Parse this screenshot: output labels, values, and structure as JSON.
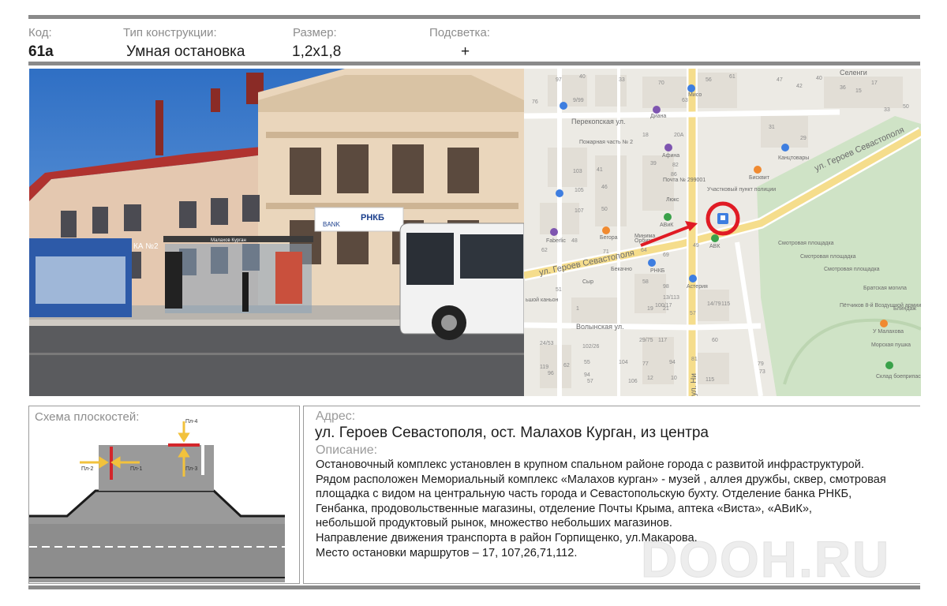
{
  "header": {
    "code_label": "Код:",
    "code_value": "61а",
    "type_label": "Тип конструкции:",
    "type_value": "Умная остановка",
    "size_label": "Размер:",
    "size_value": "1,2х1,8",
    "light_label": "Подсветка:",
    "light_value": "+"
  },
  "photo": {
    "bank_sign": "РНКБ",
    "bank_sub": "BANK",
    "stop_sign": "Малахов Курган",
    "shop_sign": "КА №2"
  },
  "map": {
    "streets": {
      "main": "ул. Героев Севастополя",
      "main_east": "ул. Героев Севастополя",
      "perekopskaya": "Перекопская ул.",
      "volynskaya": "Волынская ул.",
      "selenginskaya": "Селенги",
      "vertical": "ул. Ни"
    },
    "pois": {
      "fire": "Пожарная часть № 2",
      "diana": "Диана",
      "afina": "Афина",
      "pochta": "Почта № 299001",
      "police": "Участковый пункт полиции",
      "lux": "Люкс",
      "kanc": "Канцтовары",
      "bisquit": "Бисквит",
      "avik": "АВиК",
      "avk": "АВК",
      "faberlic": "Faberlic",
      "vegora": "Бегора",
      "orbita": "Орбита",
      "rnkb": "РНКБ",
      "bekovsky": "Бекачно",
      "asteria": "Астерия",
      "mis": "Мисо",
      "syr": "Сыр",
      "kanyon": "ьшой каньон",
      "view1": "Смотровая площадка",
      "view2": "Смотровая площадка",
      "view3": "Смотровая площадка",
      "grave": "Братская могила",
      "blindazh": "Блиндаж",
      "battery": "Пётчиков 8-й Воздушной армии",
      "malakhov": "У Малахова",
      "morskaya": "Морская пушка",
      "sklad": "Склад боеприпасов № 2",
      "mini": "Минима"
    },
    "numbers": [
      "97",
      "40",
      "33",
      "70",
      "56",
      "61",
      "47",
      "42",
      "40",
      "36",
      "9/99",
      "76",
      "63",
      "15",
      "17",
      "33",
      "50",
      "31",
      "18",
      "20А",
      "29",
      "39",
      "82",
      "103",
      "41",
      "86",
      "105",
      "46",
      "107",
      "50",
      "48",
      "71",
      "62",
      "64",
      "69",
      "49",
      "58",
      "98",
      "51",
      "13/113",
      "100/17",
      "1",
      "19",
      "21",
      "14/79",
      "115",
      "24/53",
      "102/26",
      "29/75",
      "117",
      "60",
      "55",
      "104",
      "77",
      "94",
      "81",
      "96",
      "119",
      "62",
      "57",
      "106",
      "12",
      "10",
      "79",
      "73",
      "115",
      "57",
      "94"
    ]
  },
  "scheme": {
    "title": "Схема плоскостей:",
    "plane1": "Пл-1",
    "plane2": "Пл-2",
    "plane3": "Пл-3",
    "plane4": "Пл-4"
  },
  "address": {
    "label": "Адрес:",
    "value": "ул. Героев Севастополя, ост. Малахов Курган, из центра"
  },
  "description": {
    "label": "Описание:",
    "lines": [
      "Остановочный комплекс установлен в крупном спальном районе города с развитой инфраструктурой.",
      "Рядом расположен  Мемориальный комплекс «Малахов курган» - музей , аллея дружбы, сквер,  смотровая",
      "площадка с видом на центральную часть города и  Севастопольскую бухту. Отделение банка РНКБ,",
      "Генбанка,  продовольственные магазины, отделение Почты Крыма, аптека «Виста», «АВиК»,",
      "небольшой продуктовый рынок,  множество небольших магазинов.",
      "Направление движения транспорта в район Горпищенко, ул.Макарова.",
      "Место остановки маршрутов – 17, 107,26,71,112."
    ]
  },
  "watermark": "DOOH.RU",
  "colors": {
    "rule": "#8a8a8a",
    "label": "#8d8d8d",
    "marker_red": "#e01b24",
    "road": "#9a9a9a",
    "plane_red": "#d3262b",
    "plane_yellow": "#f2c23c",
    "park": "#cfe3c6"
  }
}
